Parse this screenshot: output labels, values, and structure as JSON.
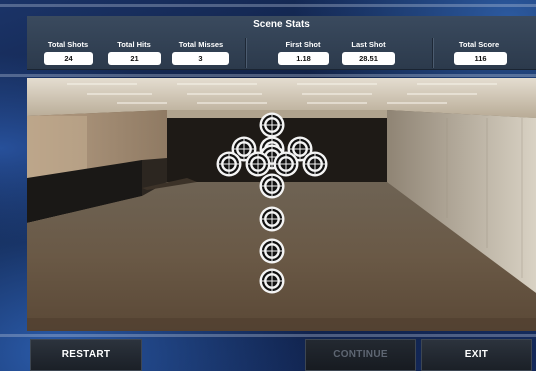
{
  "stats_panel": {
    "title": "Scene Stats",
    "total_shots": {
      "label": "Total Shots",
      "value": "24"
    },
    "total_hits": {
      "label": "Total Hits",
      "value": "21"
    },
    "total_misses": {
      "label": "Total Misses",
      "value": "3"
    },
    "first_shot": {
      "label": "First Shot",
      "value": "1.18"
    },
    "last_shot": {
      "label": "Last Shot",
      "value": "28.51"
    },
    "total_score": {
      "label": "Total Score",
      "value": "116"
    }
  },
  "buttons": {
    "restart": "RESTART",
    "continue": "CONTINUE",
    "exit": "EXIT"
  },
  "colors": {
    "panel": "#33435a",
    "button": "#22282f",
    "disabled_text": "#5e6672"
  },
  "targets": {
    "count": 13,
    "icon": "bullseye-target-icon"
  }
}
